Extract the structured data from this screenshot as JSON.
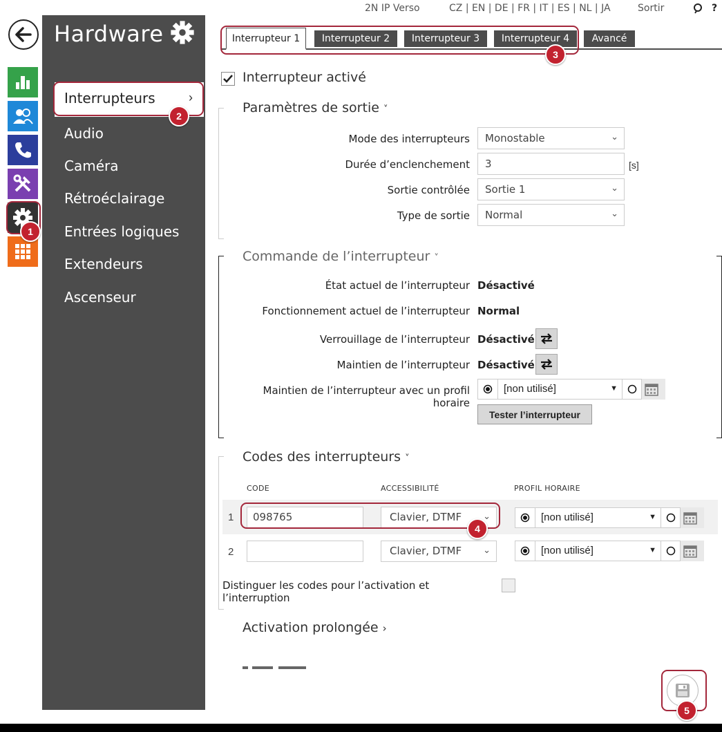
{
  "topbar": {
    "device": "2N IP Verso",
    "languages": "CZ | EN | DE | FR | IT | ES | NL | JA",
    "logout": "Sortir",
    "help": "?"
  },
  "rail": {
    "items": [
      "back-icon",
      "chart-icon",
      "users-icon",
      "phone-icon",
      "tools-icon",
      "gear-icon",
      "grid-icon"
    ],
    "colors": {
      "chart": "#35a24a",
      "users": "#1e88d8",
      "phone": "#2b3e9c",
      "tools": "#7a3fb0",
      "gear": "#333333",
      "grid": "#ef6c1a"
    }
  },
  "sidebar": {
    "title": "Hardware",
    "items": [
      {
        "label": "Interrupteurs"
      },
      {
        "label": "Audio"
      },
      {
        "label": "Caméra"
      },
      {
        "label": "Rétroéclairage"
      },
      {
        "label": "Entrées logiques"
      },
      {
        "label": "Extendeurs"
      },
      {
        "label": "Ascenseur"
      }
    ]
  },
  "tabs": [
    "Interrupteur 1",
    "Interrupteur 2",
    "Interrupteur 3",
    "Interrupteur 4",
    "Avancé"
  ],
  "switch_enabled": {
    "label": "Interrupteur activé",
    "checked": true
  },
  "output_params": {
    "title": "Paramètres de sortie",
    "mode_label": "Mode des interrupteurs",
    "mode_value": "Monostable",
    "duration_label": "Durée d’enclenchement",
    "duration_value": "3",
    "duration_unit": "[s]",
    "output_label": "Sortie contrôlée",
    "output_value": "Sortie 1",
    "type_label": "Type de sortie",
    "type_value": "Normal"
  },
  "control": {
    "title": "Commande de l’interrupteur",
    "state_label": "État actuel de l’interrupteur",
    "state_value": "Désactivé",
    "op_label": "Fonctionnement actuel de l’interrupteur",
    "op_value": "Normal",
    "lock_label": "Verrouillage de l’interrupteur",
    "lock_value": "Désactivé",
    "hold_label": "Maintien de l’interrupteur",
    "hold_value": "Désactivé",
    "hold_profile_label": "Maintien de l’interrupteur avec un profil horaire",
    "hold_profile_value": "[non utilisé]",
    "test_button": "Tester l’interrupteur"
  },
  "codes": {
    "title": "Codes des interrupteurs",
    "col_code": "CODE",
    "col_access": "ACCESSIBILITÉ",
    "col_profile": "PROFIL HORAIRE",
    "rows": [
      {
        "num": "1",
        "code": "098765",
        "access": "Clavier, DTMF",
        "profile": "[non utilisé]"
      },
      {
        "num": "2",
        "code": "",
        "access": "Clavier, DTMF",
        "profile": "[non utilisé]"
      }
    ],
    "distinguish_label": "Distinguer les codes pour l’activation et l’interruption"
  },
  "extended": {
    "title": "Activation prolongée"
  },
  "badges": [
    "1",
    "2",
    "3",
    "4",
    "5"
  ]
}
